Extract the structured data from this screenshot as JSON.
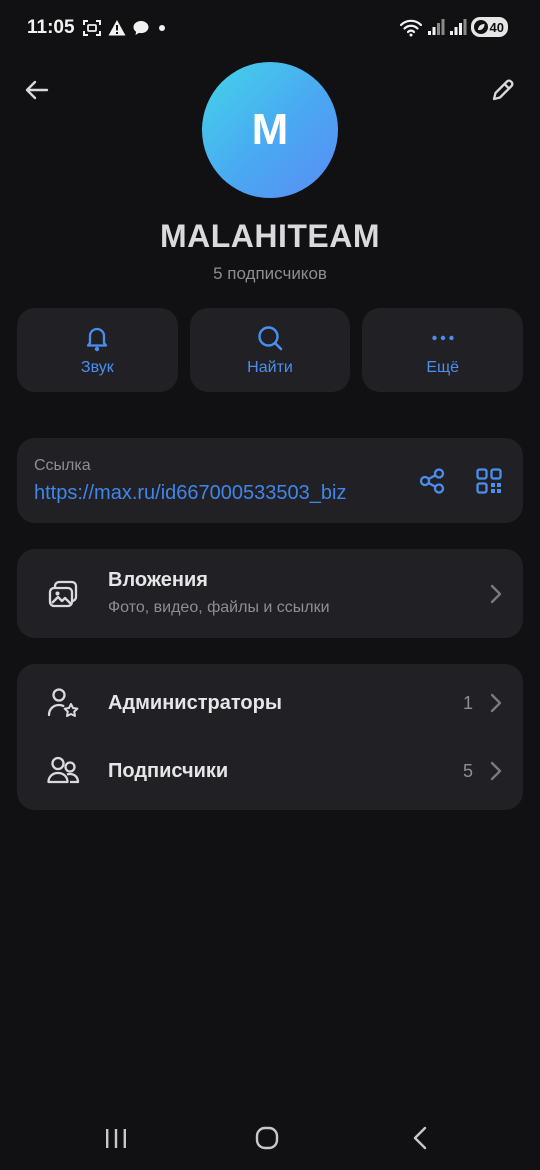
{
  "status_bar": {
    "time": "11:05",
    "battery": "40"
  },
  "header": {
    "avatar_letter": "M",
    "channel_name": "MALAHITEAM",
    "subscribers": "5 подписчиков"
  },
  "actions": {
    "sound": "Звук",
    "find": "Найти",
    "more": "Ещё"
  },
  "link": {
    "title": "Ссылка",
    "url": "https://max.ru/id667000533503_biz"
  },
  "attachments": {
    "title": "Вложения",
    "subtitle": "Фото, видео, файлы и ссылки"
  },
  "members": {
    "admins_label": "Администраторы",
    "admins_count": "1",
    "subscribers_label": "Подписчики",
    "subscribers_count": "5"
  },
  "colors": {
    "background": "#111113",
    "card": "#212125",
    "accent": "#4a8fef",
    "avatar_gradient_start": "#43d4e8",
    "avatar_gradient_end": "#5a8cf6"
  },
  "icons": {
    "back": "arrow-left-icon",
    "edit": "pencil-icon",
    "sound": "bell-icon",
    "find": "search-icon",
    "more": "dots-icon",
    "share": "share-icon",
    "qr": "qr-code-icon",
    "attachments": "gallery-icon",
    "admins": "user-star-icon",
    "subscribers": "users-icon"
  }
}
